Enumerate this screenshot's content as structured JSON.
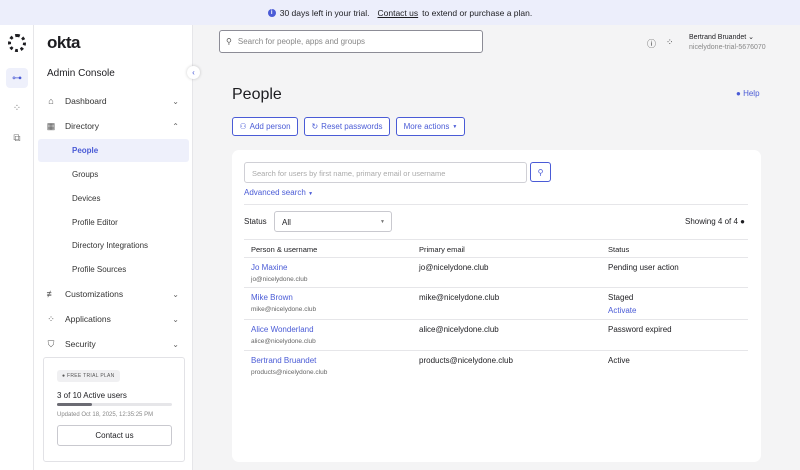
{
  "banner": {
    "text": "30 days left in your trial.",
    "link": "Contact us",
    "suffix": "to extend or purchase a plan."
  },
  "sidebar": {
    "brand": "okta",
    "title": "Admin Console",
    "items": [
      {
        "label": "Dashboard",
        "icon": "home-icon"
      },
      {
        "label": "Directory",
        "icon": "directory-icon"
      },
      {
        "label": "Customizations",
        "icon": "sliders-icon"
      },
      {
        "label": "Applications",
        "icon": "apps-icon"
      },
      {
        "label": "Security",
        "icon": "shield-icon"
      }
    ],
    "directory_sub": [
      "People",
      "Groups",
      "Devices",
      "Profile Editor",
      "Directory Integrations",
      "Profile Sources"
    ],
    "trial": {
      "badge": "FREE TRIAL PLAN",
      "users": "3 of 10 Active users",
      "progress": 0.3,
      "updated": "Updated Oct 18, 2025, 12:35:25 PM",
      "contact": "Contact us"
    }
  },
  "header": {
    "search_placeholder": "Search for people, apps and groups",
    "user_name": "Bertrand Bruandet",
    "org": "nicelydone-trial-5676070"
  },
  "page": {
    "title": "People",
    "help": "Help",
    "buttons": [
      "Add person",
      "Reset passwords",
      "More actions"
    ]
  },
  "filter": {
    "search_placeholder": "Search for users by first name, primary email or username",
    "advanced": "Advanced search",
    "status_label": "Status",
    "status_value": "All",
    "showing": "Showing 4 of 4"
  },
  "table": {
    "headers": [
      "Person & username",
      "Primary email",
      "Status"
    ],
    "rows": [
      {
        "name": "Jo Maxine",
        "username": "jo@nicelydone.club",
        "email": "jo@nicelydone.club",
        "status": "Pending user action",
        "action": ""
      },
      {
        "name": "Mike Brown",
        "username": "mike@nicelydone.club",
        "email": "mike@nicelydone.club",
        "status": "Staged",
        "action": "Activate"
      },
      {
        "name": "Alice Wonderland",
        "username": "alice@nicelydone.club",
        "email": "alice@nicelydone.club",
        "status": "Password expired",
        "action": ""
      },
      {
        "name": "Bertrand Bruandet",
        "username": "products@nicelydone.club",
        "email": "products@nicelydone.club",
        "status": "Active",
        "action": ""
      }
    ]
  }
}
